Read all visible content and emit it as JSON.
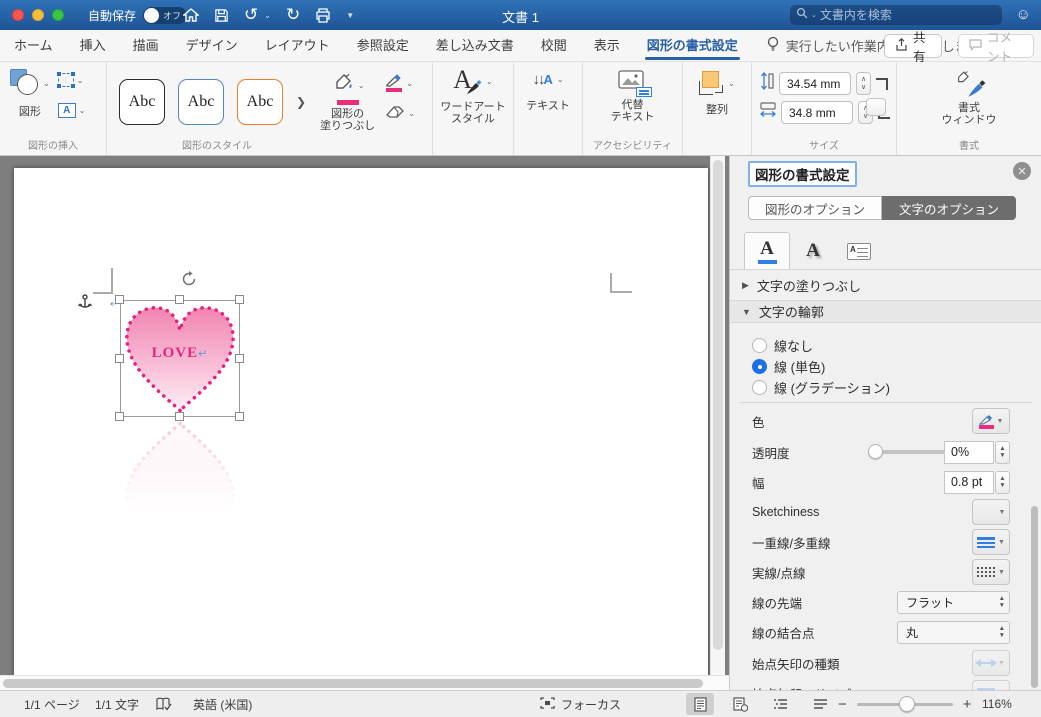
{
  "colors": {
    "accent_pink": "#ec2d7c",
    "active_tab_blue": "#2a61a6",
    "radio_blue": "#1d6fe3",
    "heart_border": "#e81f7c",
    "heart_gradient_top": "#f184b1",
    "heart_gradient_bottom": "#fdeff5",
    "titlebar_blue": "#2f72b7"
  },
  "titlebar": {
    "autosave_label": "自動保存",
    "autosave_state": "オフ",
    "title": "文書 1",
    "search_placeholder": "文書内を検索"
  },
  "tabs": {
    "items": [
      "ホーム",
      "挿入",
      "描画",
      "デザイン",
      "レイアウト",
      "参照設定",
      "差し込み文書",
      "校閲",
      "表示",
      "図形の書式設定"
    ],
    "tellme": "実行したい作業内容を入力します",
    "share": "共有",
    "comment": "コメント"
  },
  "ribbon": {
    "shapes_label": "図形",
    "insert_group": "図形の挿入",
    "styles_group": "図形のスタイル",
    "gallery": [
      "Abc",
      "Abc",
      "Abc"
    ],
    "fill_label_1": "図形の",
    "fill_label_2": "塗りつぶし",
    "wordart_1": "ワードアート",
    "wordart_2": "スタイル",
    "text_label": "テキスト",
    "alt_1": "代替",
    "alt_2": "テキスト",
    "accessibility_group": "アクセシビリティ",
    "arrange_label": "整列",
    "height_value": "34.54 mm",
    "width_value": "34.8 mm",
    "size_group": "サイズ",
    "format_1": "書式",
    "format_2": "ウィンドウ",
    "format_group": "書式"
  },
  "pane": {
    "title": "図形の書式設定",
    "tab_shape_options": "図形のオプション",
    "tab_text_options": "文字のオプション",
    "section_text_fill": "文字の塗りつぶし",
    "section_text_outline": "文字の輪郭",
    "radio_no_line": "線なし",
    "radio_solid_line": "線 (単色)",
    "radio_gradient_line": "線 (グラデーション)",
    "color_label": "色",
    "transparency_label": "透明度",
    "transparency_value": "0%",
    "width_label": "幅",
    "width_value": "0.8 pt",
    "sketchiness_label": "Sketchiness",
    "compound_label": "一重線/多重線",
    "dash_label": "実線/点線",
    "cap_label": "線の先端",
    "cap_value": "フラット",
    "join_label": "線の結合点",
    "join_value": "丸",
    "begin_arrow_type_label": "始点矢印の種類",
    "begin_arrow_size_label": "始点矢印のサイズ"
  },
  "document": {
    "shape_text": "LOVE"
  },
  "statusbar": {
    "pages": "1/1 ページ",
    "words": "1/1 文字",
    "language": "英語 (米国)",
    "focus_label": "フォーカス",
    "zoom_value": "116%"
  }
}
